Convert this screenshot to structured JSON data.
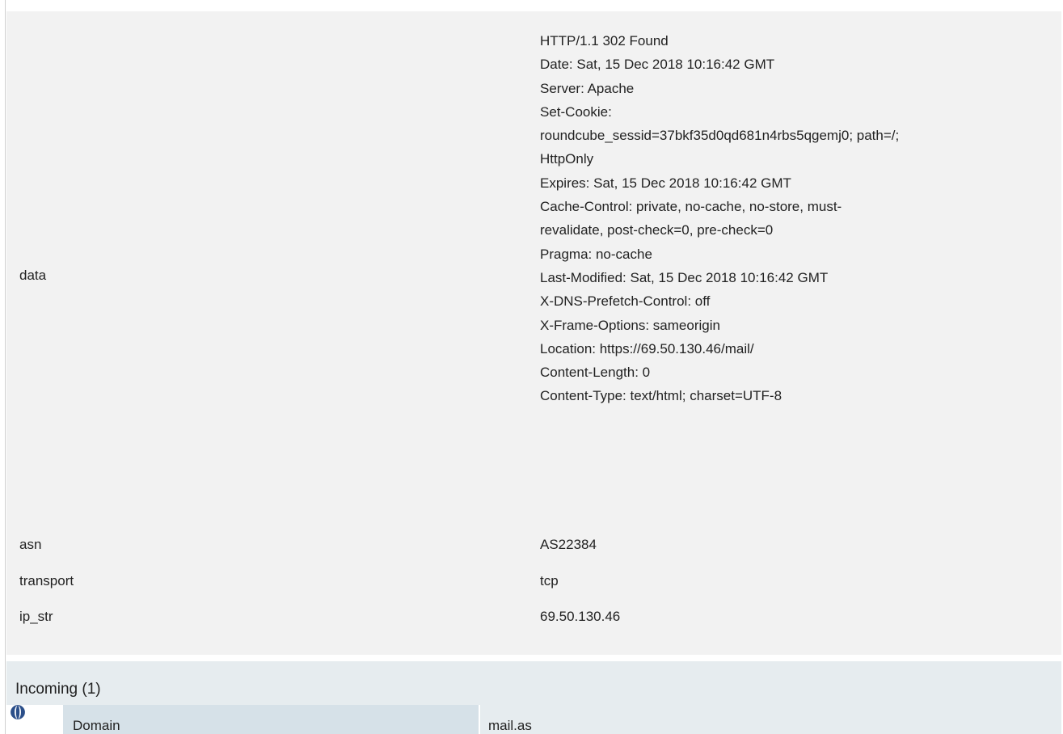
{
  "properties": {
    "data": {
      "key": "data",
      "lines": [
        "HTTP/1.1 302 Found",
        "Date: Sat, 15 Dec 2018 10:16:42 GMT",
        "Server: Apache",
        "Set-Cookie:",
        "roundcube_sessid=37bkf35d0qd681n4rbs5qgemj0; path=/;",
        "HttpOnly",
        "Expires: Sat, 15 Dec 2018 10:16:42 GMT",
        "Cache-Control: private, no-cache, no-store, must-",
        "revalidate, post-check=0, pre-check=0",
        "Pragma: no-cache",
        "Last-Modified: Sat, 15 Dec 2018 10:16:42 GMT",
        "X-DNS-Prefetch-Control: off",
        "X-Frame-Options: sameorigin",
        "Location: https://69.50.130.46/mail/",
        "Content-Length: 0",
        "Content-Type: text/html; charset=UTF-8"
      ]
    },
    "asn": {
      "key": "asn",
      "value": "AS22384"
    },
    "transport": {
      "key": "transport",
      "value": "tcp"
    },
    "ip_str": {
      "key": "ip_str",
      "value": "69.50.130.46"
    }
  },
  "incoming": {
    "title": "Incoming (1)",
    "rows": [
      {
        "icon": "globe-icon",
        "label": "Domain",
        "value": "mail.as"
      }
    ]
  },
  "colors": {
    "panel": "#f2f2f2",
    "incoming_header": "#e6ecef",
    "domain_label_bg": "#d6e1e8",
    "icon_blue": "#2b4f8a"
  }
}
